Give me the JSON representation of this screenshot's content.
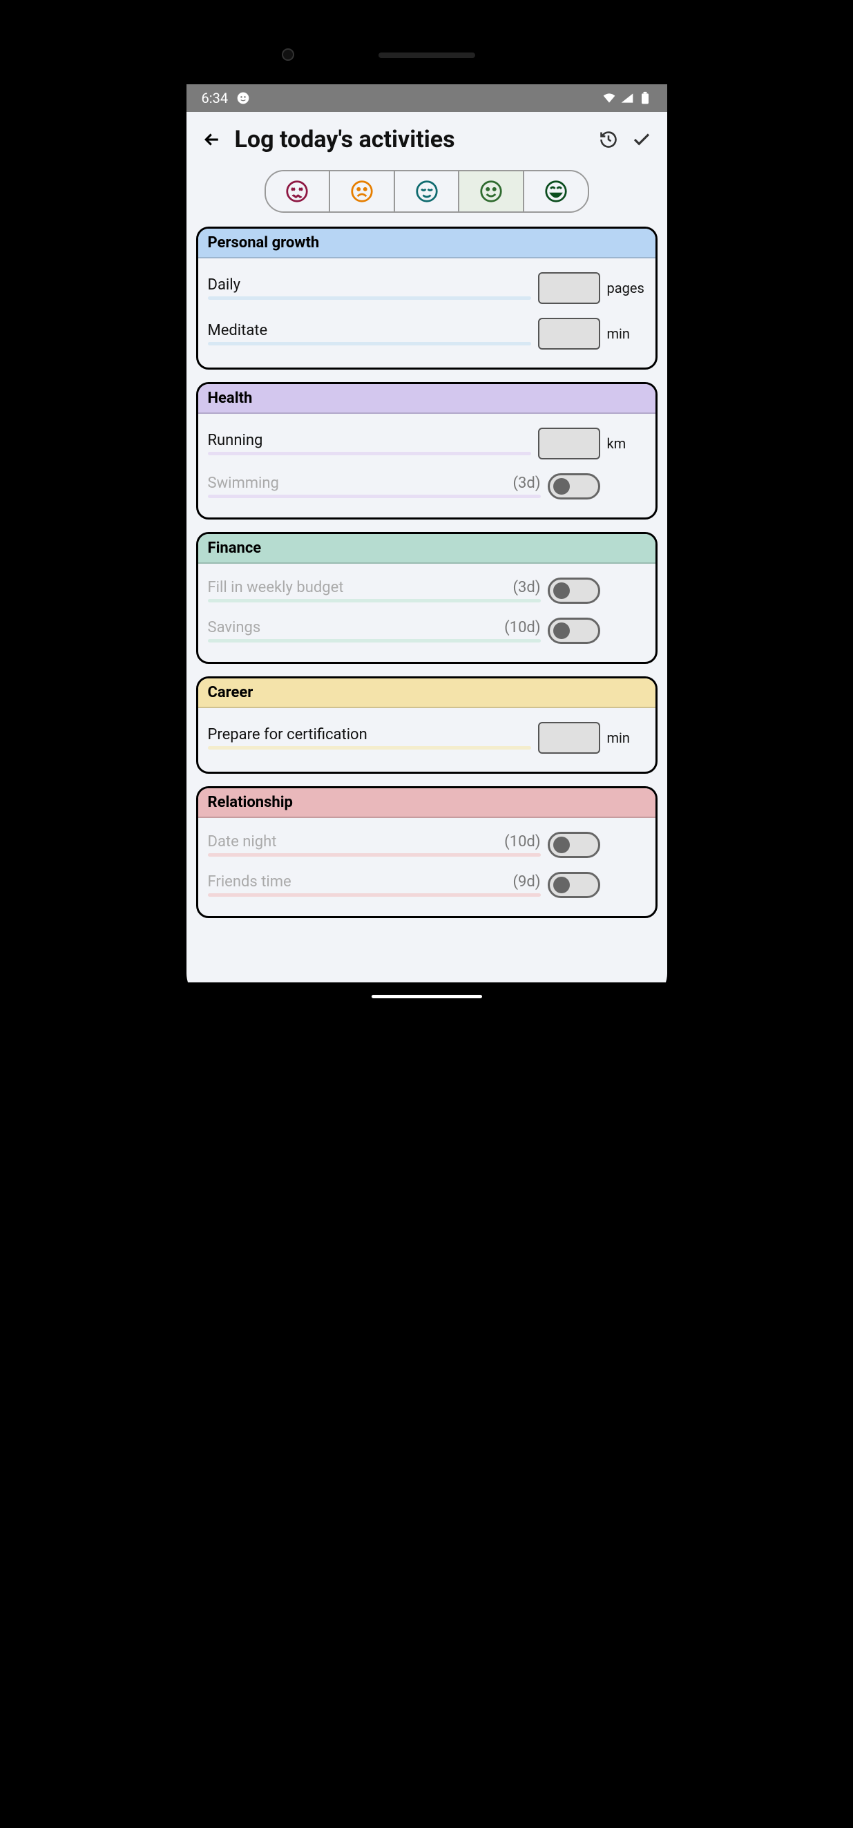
{
  "status": {
    "time": "6:34"
  },
  "header": {
    "title": "Log today's activities"
  },
  "moods": {
    "selected_index": 3,
    "colors": [
      "#8e1742",
      "#e67e00",
      "#0f6b6f",
      "#2f6b2f",
      "#0b4d1e"
    ]
  },
  "categories": [
    {
      "name": "Personal growth",
      "header_bg": "#b7d5f4",
      "underline": "#d8e8f4",
      "items": [
        {
          "label": "Daily",
          "kind": "number",
          "unit": "pages",
          "muted": false
        },
        {
          "label": "Meditate",
          "kind": "number",
          "unit": "min",
          "muted": false
        }
      ]
    },
    {
      "name": "Health",
      "header_bg": "#d3c7ee",
      "underline": "#e7def4",
      "items": [
        {
          "label": "Running",
          "kind": "number",
          "unit": "km",
          "muted": false
        },
        {
          "label": "Swimming",
          "kind": "toggle",
          "interval": "(3d)",
          "muted": true
        }
      ]
    },
    {
      "name": "Finance",
      "header_bg": "#b6dcd0",
      "underline": "#d6ece4",
      "items": [
        {
          "label": "Fill in weekly budget",
          "kind": "toggle",
          "interval": "(3d)",
          "muted": true
        },
        {
          "label": "Savings",
          "kind": "toggle",
          "interval": "(10d)",
          "muted": true
        }
      ]
    },
    {
      "name": "Career",
      "header_bg": "#f4e3aa",
      "underline": "#f4edcd",
      "items": [
        {
          "label": "Prepare for certification",
          "kind": "number",
          "unit": "min",
          "muted": false
        }
      ]
    },
    {
      "name": "Relationship",
      "header_bg": "#e9b8bb",
      "underline": "#f2d7d9",
      "items": [
        {
          "label": "Date night",
          "kind": "toggle",
          "interval": "(10d)",
          "muted": true
        },
        {
          "label": "Friends time",
          "kind": "toggle",
          "interval": "(9d)",
          "muted": true
        }
      ]
    }
  ]
}
